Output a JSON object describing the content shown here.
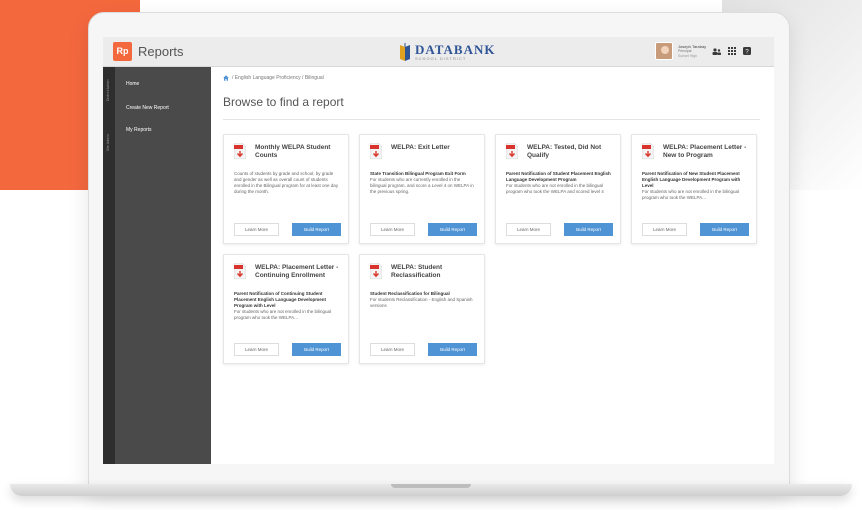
{
  "header": {
    "logo_abbr": "Rp",
    "app_name": "Reports",
    "brand_name": "DATABANK",
    "brand_tagline": "SCHOOL DISTRICT",
    "user_name": "Joseph Tarabay",
    "user_role": "Principal",
    "user_school": "Sunset High"
  },
  "rail": {
    "tab_1": "District Admin",
    "tab_2": "Site Admin"
  },
  "sidebar": {
    "items": [
      {
        "label": "Home"
      },
      {
        "label": "Create New Report"
      },
      {
        "label": "My Reports"
      }
    ]
  },
  "main": {
    "breadcrumb": "/ English Language Proficiency / Bilingual",
    "page_title": "Browse to find a report",
    "learn_label": "Learn More",
    "build_label": "Build Report",
    "cards": [
      {
        "title": "Monthly WELPA Student Counts",
        "desc_bold": "",
        "desc": "Counts of students by grade and school, by grade and gender as well as overall count of students enrolled in the Bilingual program for at least one day during the month."
      },
      {
        "title": "WELPA: Exit Letter",
        "desc_bold": "State Transition Bilingual Program Exit Form",
        "desc": "For students who are currently enrolled in the bilingual program, and score a Level 4 on WELPA in the previous spring."
      },
      {
        "title": "WELPA: Tested, Did Not Qualify",
        "desc_bold": "Parent Notification of Student Placement English Language Development Program",
        "desc": "For students who are not enrolled in the bilingual program who took the WELPA and scored level 4"
      },
      {
        "title": "WELPA: Placement Letter - New to Program",
        "desc_bold": "Parent Notification of New Student Placement English Language Development Program with Level",
        "desc": "For students who are not enrolled in the bilingual program who took the WELPA..."
      },
      {
        "title": "WELPA: Placement Letter - Continuing Enrollment",
        "desc_bold": "Parent Notification of Continuing Student Placement English Language Development Program with Level",
        "desc": "For students who are not enrolled in the bilingual program who took the WELPA..."
      },
      {
        "title": "WELPA: Student Reclassification",
        "desc_bold": "Student Reclassification for Bilingual",
        "desc": "For students Reclassification - English and Spanish versions"
      }
    ]
  },
  "colors": {
    "accent_orange": "#f4683e",
    "build_button": "#4f94d4",
    "sidebar": "#4a4a4a",
    "brand_blue": "#2f5597",
    "pdf_red": "#d9342b"
  },
  "icons": {
    "breadcrumb": "home-icon",
    "card": "pdf-icon",
    "header": [
      "users-icon",
      "grid-icon",
      "help-icon"
    ]
  }
}
